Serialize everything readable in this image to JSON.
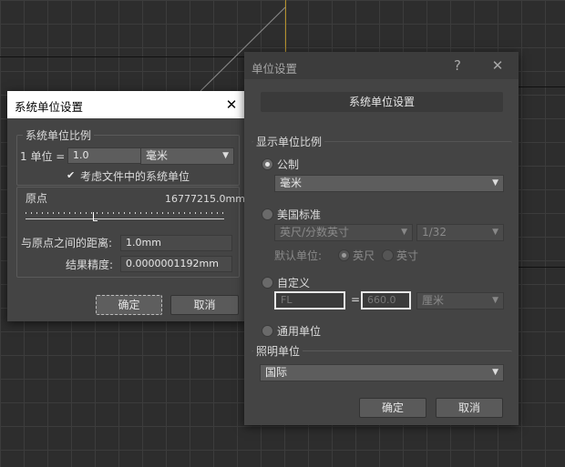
{
  "system_unit_dialog": {
    "title": "系统单位设置",
    "group_title": "系统单位比例",
    "scale_prefix": "1 单位 =",
    "scale_value": "1.0",
    "unit_selected": "毫米",
    "consider_files_label": "考虑文件中的系统单位",
    "consider_files_checked": true,
    "origin_label": "原点",
    "origin_value": "16777215.0mm",
    "distance_label": "与原点之间的距离:",
    "distance_value": "1.0mm",
    "precision_label": "结果精度:",
    "precision_value": "0.0000001192mm",
    "ok_label": "确定",
    "cancel_label": "取消",
    "close_glyph": "✕"
  },
  "unit_setup_dialog": {
    "title": "单位设置",
    "help_glyph": "?",
    "close_glyph": "✕",
    "system_unit_button": "系统单位设置",
    "display_group_title": "显示单位比例",
    "metric_label": "公制",
    "metric_selected": true,
    "metric_unit": "毫米",
    "us_label": "美国标准",
    "us_unit": "英尺/分数英寸",
    "us_fraction": "1/32",
    "default_unit_label": "默认单位:",
    "feet_label": "英尺",
    "inch_label": "英寸",
    "custom_label": "自定义",
    "custom_name": "FL",
    "custom_equals": "=",
    "custom_value": "660.0",
    "custom_unit": "厘米",
    "generic_label": "通用单位",
    "lighting_group_title": "照明单位",
    "lighting_unit": "国际",
    "ok_label": "确定",
    "cancel_label": "取消"
  },
  "icons": {
    "dropdown_arrow": "▼",
    "checkmark": "✔"
  }
}
